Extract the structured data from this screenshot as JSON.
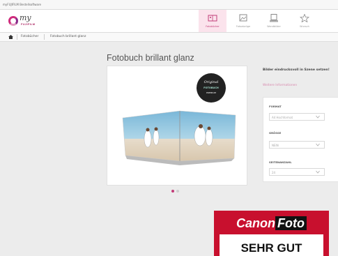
{
  "window": {
    "title": "myFUJIFILM Bestellsoftware"
  },
  "brand": {
    "script": "my",
    "name": "FUJIFILM",
    "accent": "#c23c78"
  },
  "nav": {
    "tabs": [
      {
        "label": "Fotobücher",
        "icon": "photobook-icon",
        "active": true
      },
      {
        "label": "Fotoabzüge",
        "icon": "prints-icon",
        "active": false
      },
      {
        "label": "Wandbilder",
        "icon": "wall-art-icon",
        "active": false
      },
      {
        "label": "Wunsch",
        "icon": "star-icon",
        "active": false
      }
    ]
  },
  "breadcrumb": {
    "items": [
      "Fotobücher",
      "Fotobuch brillant glanz"
    ]
  },
  "product": {
    "title": "Fotobuch brillant glanz",
    "sticker": {
      "line1": "Original",
      "line2": "FOTOBUCH",
      "line3": "PREMIUM"
    }
  },
  "carousel": {
    "active_index": 1,
    "count": 2
  },
  "info": {
    "headline": "Bilder eindrucksvoll in Szene setzen!",
    "more_link": "Weitere Informationen"
  },
  "options": {
    "format": {
      "label": "FORMAT",
      "value": "A4 Hochformat"
    },
    "size": {
      "label": "GRÖSSE",
      "value": "NEIN"
    },
    "pages": {
      "label": "SEITENANZAHL",
      "value": "24"
    }
  },
  "overlay": {
    "brand_canon": "Canon",
    "brand_foto": "Foto",
    "rating": "SEHR GUT"
  }
}
